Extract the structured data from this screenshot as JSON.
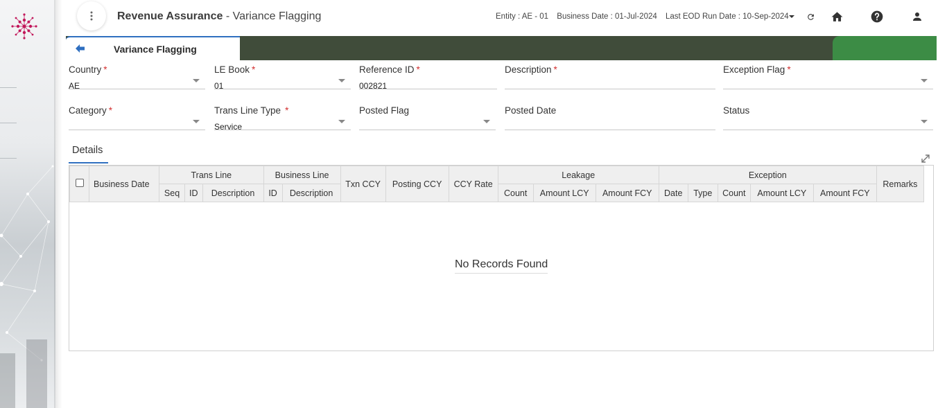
{
  "header": {
    "app_name": "Revenue Assurance",
    "separator": " - ",
    "screen_name": "Variance Flagging",
    "entity": "Entity : AE - 01",
    "business_date": "Business Date : 01-Jul-2024",
    "last_eod": "Last EOD Run Date : 10-Sep-2024",
    "icons": [
      "more-vert-icon",
      "chevron-down-icon",
      "refresh-icon",
      "home-icon",
      "help-icon",
      "user-icon"
    ]
  },
  "tabs": {
    "active_label": "Variance Flagging",
    "colors": {
      "strip": "#404c3a",
      "green": "#3c8c45",
      "accent": "#2f6fc0"
    }
  },
  "form": {
    "country": {
      "label": "Country",
      "value": "AE",
      "required": "*"
    },
    "le_book": {
      "label": "LE Book",
      "value": "01",
      "required": "*"
    },
    "reference_id": {
      "label": "Reference ID",
      "value": "002821",
      "required": "*"
    },
    "description": {
      "label": "Description",
      "value": "",
      "required": "*"
    },
    "exception_flag": {
      "label": "Exception Flag",
      "value": "",
      "required": "*"
    },
    "category": {
      "label": "Category",
      "value": "",
      "required": "*"
    },
    "trans_line_type": {
      "label": "Trans Line Type",
      "value": "Service",
      "required": "*"
    },
    "posted_flag": {
      "label": "Posted Flag",
      "value": ""
    },
    "posted_date": {
      "label": "Posted Date",
      "value": ""
    },
    "status": {
      "label": "Status",
      "value": ""
    }
  },
  "details": {
    "tab_label": "Details",
    "columns": {
      "business_date": "Business Date",
      "trans_line": "Trans Line",
      "seq": "Seq",
      "tl_id": "ID",
      "tl_description": "Description",
      "business_line": "Business Line",
      "bl_id": "ID",
      "bl_description": "Description",
      "txn_ccy": "Txn CCY",
      "posting_ccy": "Posting CCY",
      "ccy_rate": "CCY Rate",
      "leakage": "Leakage",
      "lk_count": "Count",
      "lk_amount_lcy": "Amount LCY",
      "lk_amount_fcy": "Amount FCY",
      "exception": "Exception",
      "ex_date": "Date",
      "ex_type": "Type",
      "ex_count": "Count",
      "ex_amount_lcy": "Amount LCY",
      "ex_amount_fcy": "Amount FCY",
      "remarks": "Remarks"
    },
    "rows": [],
    "empty_message": "No Records Found"
  }
}
